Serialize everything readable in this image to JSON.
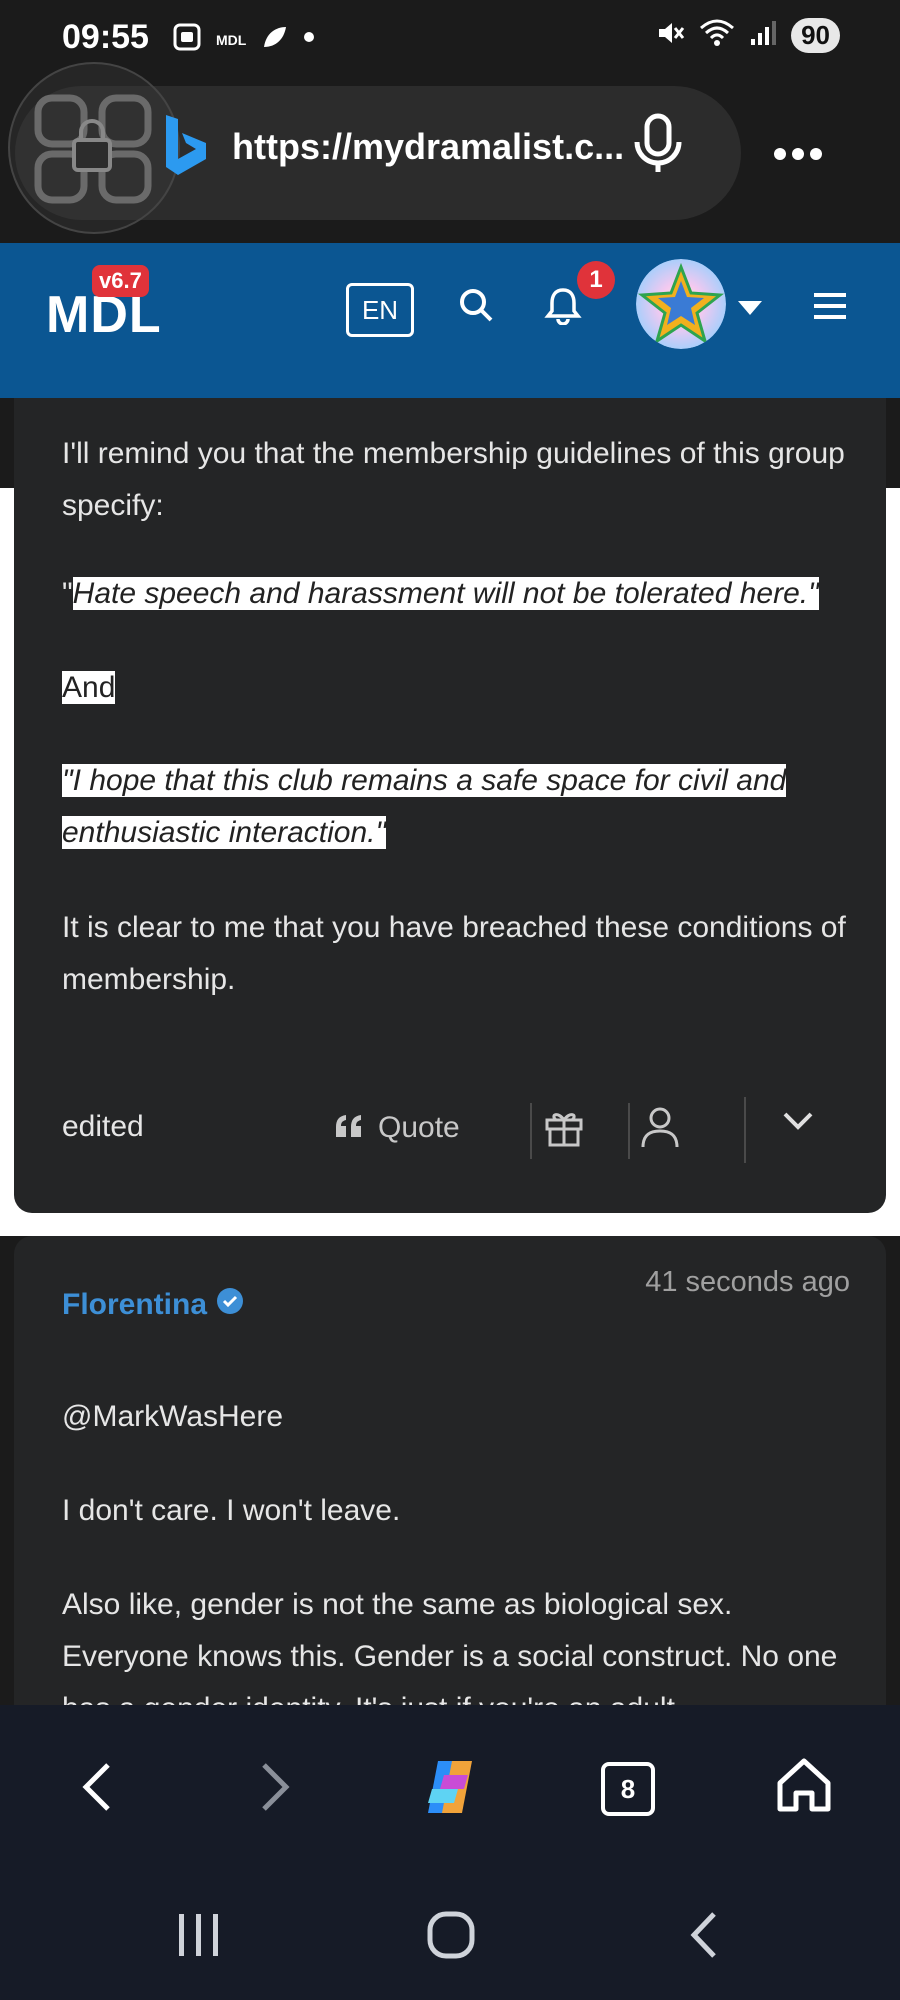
{
  "status_bar": {
    "time": "09:55",
    "app_tag": "MDL",
    "battery": "90",
    "icons": [
      "screenshot-icon",
      "mdl-icon",
      "leaf-icon",
      "dot-icon",
      "mute-icon",
      "wifi-icon",
      "signal-icon"
    ]
  },
  "browser": {
    "url": "https://mydramalist.c...",
    "icons": [
      "lock-overlay-icon",
      "bing-icon",
      "microphone-icon",
      "more-icon"
    ]
  },
  "site_header": {
    "logo": "MDL",
    "version": "v6.7",
    "language": "EN",
    "notification_count": "1",
    "colors": {
      "header_bg": "#0b5692",
      "badge": "#e0333a"
    }
  },
  "comment1": {
    "intro": "I'll remind you that the membership guidelines of this group specify:",
    "quote1_open": "\"",
    "quote1": "Hate speech and harassment will not be tolerated here.\"",
    "and": "And",
    "quote2_line1": "\"I hope that this club remains a safe space for civil and",
    "quote2_line2": "enthusiastic interaction.\"",
    "conclusion": "It is clear to me that you have breached these conditions of membership.",
    "edited": "edited",
    "quote_label": "Quote"
  },
  "comment2": {
    "author": "Florentina",
    "time": "41 seconds ago",
    "mention": "@MarkWasHere",
    "line1": "I don't care. I won't leave.",
    "line2": "Also like, gender is not the same as biological sex. Everyone knows this. Gender is a social construct. No one has a gender identity. It's just if you're an adult"
  },
  "bottom_nav": {
    "tabs": "8"
  }
}
